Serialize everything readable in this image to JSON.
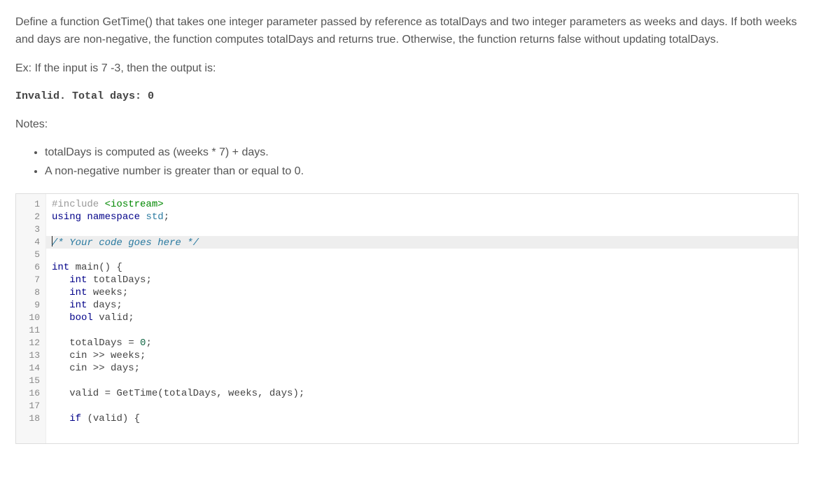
{
  "prompt": {
    "p1": "Define a function GetTime() that takes one integer parameter passed by reference as totalDays and two integer parameters as weeks and days. If both weeks and days are non-negative, the function computes totalDays and returns true. Otherwise, the function returns false without updating totalDays.",
    "p2_pre": "Ex: If the input is ",
    "p2_input": "7 -3",
    "p2_post": ", then the output is:",
    "output": "Invalid. Total days: 0",
    "notes_label": "Notes:",
    "notes": [
      "totalDays is computed as (weeks * 7) + days.",
      "A non-negative number is greater than or equal to 0."
    ]
  },
  "editor": {
    "active_line": 4,
    "lines": [
      {
        "n": 1,
        "tokens": [
          {
            "t": "#include ",
            "c": "pre"
          },
          {
            "t": "<iostream>",
            "c": "str"
          }
        ]
      },
      {
        "n": 2,
        "tokens": [
          {
            "t": "using ",
            "c": "kw"
          },
          {
            "t": "namespace ",
            "c": "kw"
          },
          {
            "t": "std",
            "c": "ns"
          },
          {
            "t": ";",
            "c": ""
          }
        ]
      },
      {
        "n": 3,
        "tokens": []
      },
      {
        "n": 4,
        "tokens": [
          {
            "t": "/* Your code goes here */",
            "c": "cm"
          }
        ]
      },
      {
        "n": 5,
        "tokens": []
      },
      {
        "n": 6,
        "tokens": [
          {
            "t": "int ",
            "c": "typ"
          },
          {
            "t": "main() {",
            "c": ""
          }
        ]
      },
      {
        "n": 7,
        "tokens": [
          {
            "t": "   ",
            "c": ""
          },
          {
            "t": "int ",
            "c": "typ"
          },
          {
            "t": "totalDays;",
            "c": ""
          }
        ]
      },
      {
        "n": 8,
        "tokens": [
          {
            "t": "   ",
            "c": ""
          },
          {
            "t": "int ",
            "c": "typ"
          },
          {
            "t": "weeks;",
            "c": ""
          }
        ]
      },
      {
        "n": 9,
        "tokens": [
          {
            "t": "   ",
            "c": ""
          },
          {
            "t": "int ",
            "c": "typ"
          },
          {
            "t": "days;",
            "c": ""
          }
        ]
      },
      {
        "n": 10,
        "tokens": [
          {
            "t": "   ",
            "c": ""
          },
          {
            "t": "bool ",
            "c": "typ"
          },
          {
            "t": "valid;",
            "c": ""
          }
        ]
      },
      {
        "n": 11,
        "tokens": []
      },
      {
        "n": 12,
        "tokens": [
          {
            "t": "   totalDays = ",
            "c": ""
          },
          {
            "t": "0",
            "c": "num"
          },
          {
            "t": ";",
            "c": ""
          }
        ]
      },
      {
        "n": 13,
        "tokens": [
          {
            "t": "   cin >> weeks;",
            "c": ""
          }
        ]
      },
      {
        "n": 14,
        "tokens": [
          {
            "t": "   cin >> days;",
            "c": ""
          }
        ]
      },
      {
        "n": 15,
        "tokens": []
      },
      {
        "n": 16,
        "tokens": [
          {
            "t": "   valid = GetTime(totalDays, weeks, days);",
            "c": ""
          }
        ]
      },
      {
        "n": 17,
        "tokens": []
      },
      {
        "n": 18,
        "tokens": [
          {
            "t": "   ",
            "c": ""
          },
          {
            "t": "if ",
            "c": "kw"
          },
          {
            "t": "(valid) {",
            "c": ""
          }
        ]
      }
    ]
  }
}
